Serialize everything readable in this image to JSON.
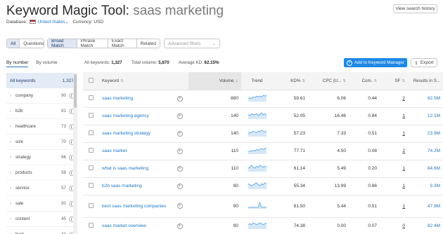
{
  "header": {
    "title_main": "Keyword Magic Tool:",
    "title_query": "saas marketing",
    "view_history": "View search history",
    "database_label": "Database:",
    "database_value": "United States",
    "currency_label": "Currency:",
    "currency_value": "USD"
  },
  "filters": {
    "all": "All",
    "questions": "Questions",
    "match_types": [
      "Broad Match",
      "Phrase Match",
      "Exact Match",
      "Related"
    ],
    "advanced_placeholder": "Advanced filters"
  },
  "sidebar": {
    "tabs": [
      "By number",
      "By volume"
    ],
    "all_label": "All keywords",
    "all_count": "1,327",
    "items": [
      {
        "label": "company",
        "count": "90"
      },
      {
        "label": "b2b",
        "count": "81"
      },
      {
        "label": "healthcare",
        "count": "73"
      },
      {
        "label": "size",
        "count": "70"
      },
      {
        "label": "strategy",
        "count": "66"
      },
      {
        "label": "products",
        "count": "58"
      },
      {
        "label": "service",
        "count": "57"
      },
      {
        "label": "sale",
        "count": "50"
      },
      {
        "label": "content",
        "count": "45"
      },
      {
        "label": "best",
        "count": "44"
      }
    ]
  },
  "summary": {
    "all_keywords_label": "All keywords:",
    "all_keywords_value": "1,327",
    "total_volume_label": "Total volume:",
    "total_volume_value": "5,870",
    "avg_kd_label": "Average KD:",
    "avg_kd_value": "62.15%",
    "add_button": "Add to Keyword Manager",
    "export_button": "Export"
  },
  "table": {
    "headers": {
      "keyword": "Keyword",
      "volume": "Volume",
      "trend": "Trend",
      "kd": "KD%",
      "cpc": "CPC (U...",
      "com": "Com.",
      "sf": "SF",
      "results": "Results in S..."
    },
    "rows": [
      {
        "keyword": "saas marketing",
        "volume": "880",
        "kd": "59.61",
        "cpc": "6.06",
        "com": "0.44",
        "sf": "2",
        "results": "82.5M",
        "trend": [
          3,
          4,
          3,
          5,
          4,
          6,
          5,
          6,
          5,
          7,
          6,
          7
        ]
      },
      {
        "keyword": "saas marketing agency",
        "volume": "140",
        "kd": "52.05",
        "cpc": "16.46",
        "com": "0.84",
        "sf": "1",
        "results": "12.1M",
        "trend": [
          4,
          3,
          5,
          4,
          4,
          5,
          3,
          4,
          6,
          4,
          5,
          4
        ]
      },
      {
        "keyword": "saas marketing strategy",
        "volume": "140",
        "kd": "57.23",
        "cpc": "7.33",
        "com": "0.51",
        "sf": "1",
        "results": "23.9M",
        "trend": [
          3,
          5,
          4,
          6,
          5,
          4,
          6,
          5,
          7,
          6,
          5,
          6
        ]
      },
      {
        "keyword": "saas market",
        "volume": "110",
        "kd": "77.71",
        "cpc": "4.50",
        "com": "0.08",
        "sf": "2",
        "results": "74.2M",
        "trend": [
          2,
          3,
          3,
          4,
          3,
          5,
          4,
          5,
          6,
          5,
          6,
          7
        ]
      },
      {
        "keyword": "what is saas marketing",
        "volume": "110",
        "kd": "61.14",
        "cpc": "5.49",
        "com": "0.20",
        "sf": "1",
        "results": "84.6M",
        "trend": [
          3,
          4,
          6,
          4,
          3,
          5,
          4,
          6,
          5,
          4,
          5,
          4
        ]
      },
      {
        "keyword": "b2b saas marketing",
        "volume": "90",
        "kd": "55.34",
        "cpc": "13.99",
        "com": "0.86",
        "sf": "1",
        "results": "9.3M",
        "trend": [
          5,
          4,
          3,
          4,
          5,
          6,
          4,
          3,
          5,
          4,
          6,
          5
        ]
      },
      {
        "keyword": "best saas marketing companies",
        "volume": "90",
        "kd": "61.50",
        "cpc": "5.44",
        "com": "0.51",
        "sf": "1",
        "results": "47.9M",
        "trend": [
          1,
          1,
          1,
          1,
          1,
          1,
          1,
          7,
          1,
          1,
          1,
          1
        ]
      },
      {
        "keyword": "saas market overview",
        "volume": "90",
        "kd": "74.38",
        "cpc": "0.00",
        "com": "0.07",
        "sf": "0",
        "results": "82.4M",
        "trend": [
          4,
          5,
          4,
          6,
          5,
          4,
          5,
          6,
          5,
          4,
          5,
          6
        ]
      }
    ]
  },
  "colors": {
    "accent": "#1e88e5",
    "link": "#1e78c8",
    "trend": "#6aaee8"
  }
}
